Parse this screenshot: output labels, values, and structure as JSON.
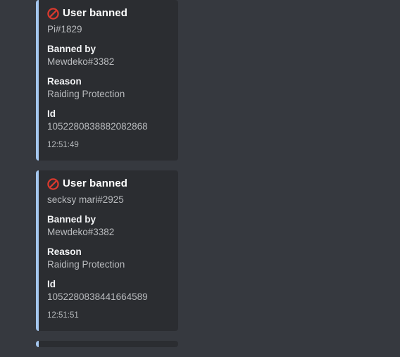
{
  "app": {
    "background_color": "#36393f",
    "embed_background_color": "#2b2d31",
    "embed_accent_color": "#a5c7ef",
    "title_color": "#ffffff",
    "text_color": "#b9bbbe"
  },
  "embeds": [
    {
      "icon": "no-entry-sign-icon",
      "title": "User banned",
      "description": "Pi#1829",
      "fields": [
        {
          "name": "Banned by",
          "value": "Mewdeko#3382"
        },
        {
          "name": "Reason",
          "value": "Raiding Protection"
        },
        {
          "name": "Id",
          "value": "1052280838882082868"
        }
      ],
      "footer": "12:51:49"
    },
    {
      "icon": "no-entry-sign-icon",
      "title": "User banned",
      "description": "secksy mari#2925",
      "fields": [
        {
          "name": "Banned by",
          "value": "Mewdeko#3382"
        },
        {
          "name": "Reason",
          "value": "Raiding Protection"
        },
        {
          "name": "Id",
          "value": "1052280838441664589"
        }
      ],
      "footer": "12:51:51"
    }
  ]
}
